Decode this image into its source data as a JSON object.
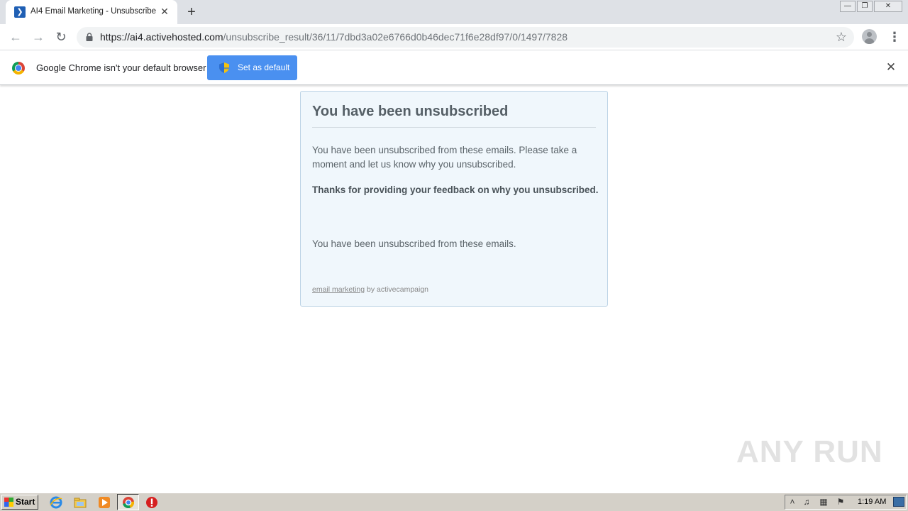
{
  "browser": {
    "tab_title": "AI4 Email Marketing - Unsubscribe",
    "new_tab_symbol": "+",
    "url_host": "https://ai4.activehosted.com",
    "url_path": "/unsubscribe_result/36/11/7dbd3a02e6766d0b46dec71f6e28df97/0/1497/7828",
    "infobar_text": "Google Chrome isn't your default browser",
    "set_default_label": "Set as default",
    "accent_color": "#4a90f0"
  },
  "page": {
    "title": "You have been unsubscribed",
    "paragraph_1": "You have been unsubscribed from these emails. Please take a moment and let us know why you unsubscribed.",
    "paragraph_2": "Thanks for providing your feedback on why you unsubscribed.",
    "paragraph_3": "You have been unsubscribed from these emails.",
    "footer_link": "email marketing",
    "footer_suffix": " by activecampaign"
  },
  "watermark": "ANY RUN",
  "taskbar": {
    "start_label": "Start",
    "clock": "1:19 AM",
    "icons": [
      "ie-icon",
      "explorer-icon",
      "media-player-icon",
      "chrome-icon",
      "stop-icon"
    ]
  }
}
